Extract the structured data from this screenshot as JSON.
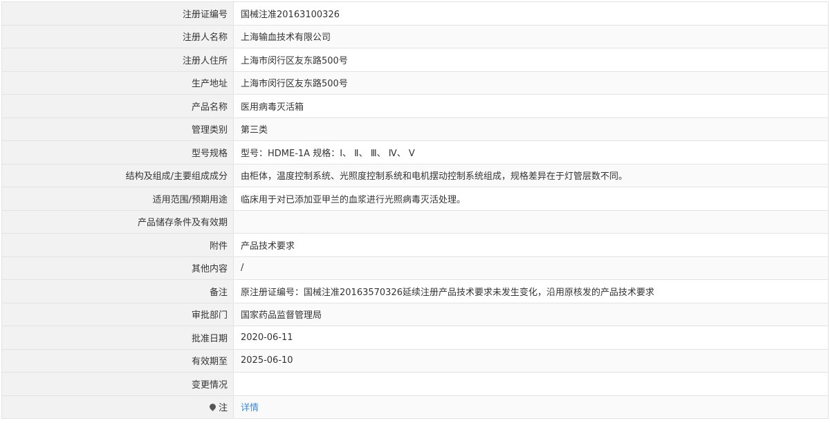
{
  "rows": [
    {
      "label": "注册证编号",
      "value": "国械注准20163100326"
    },
    {
      "label": "注册人名称",
      "value": "上海输血技术有限公司"
    },
    {
      "label": "注册人住所",
      "value": "上海市闵行区友东路500号"
    },
    {
      "label": "生产地址",
      "value": "上海市闵行区友东路500号"
    },
    {
      "label": "产品名称",
      "value": "医用病毒灭活箱"
    },
    {
      "label": "管理类别",
      "value": "第三类"
    },
    {
      "label": "型号规格",
      "value": "型号：HDME-1A 规格：Ⅰ、 Ⅱ、 Ⅲ、 Ⅳ、 Ⅴ"
    },
    {
      "label": "结构及组成/主要组成成分",
      "value": "由柜体，温度控制系统、光照度控制系统和电机摆动控制系统组成，规格差异在于灯管层数不同。"
    },
    {
      "label": "适用范围/预期用途",
      "value": "临床用于对已添加亚甲兰的血浆进行光照病毒灭活处理。"
    },
    {
      "label": "产品储存条件及有效期",
      "value": ""
    },
    {
      "label": "附件",
      "value": "产品技术要求"
    },
    {
      "label": "其他内容",
      "value": "/"
    },
    {
      "label": "备注",
      "value": "原注册证编号：国械注准20163570326延续注册产品技术要求未发生变化，沿用原核发的产品技术要求"
    },
    {
      "label": "审批部门",
      "value": "国家药品监督管理局"
    },
    {
      "label": "批准日期",
      "value": "2020-06-11"
    },
    {
      "label": "有效期至",
      "value": "2025-06-10"
    },
    {
      "label": "变更情况",
      "value": ""
    }
  ],
  "note_row": {
    "icon": "pin-icon",
    "label": "注",
    "link_text": "详情"
  },
  "colors": {
    "label_bg": "#f2f2f2",
    "border": "#e3e3e3",
    "link": "#3d8bd6",
    "text": "#333333"
  }
}
